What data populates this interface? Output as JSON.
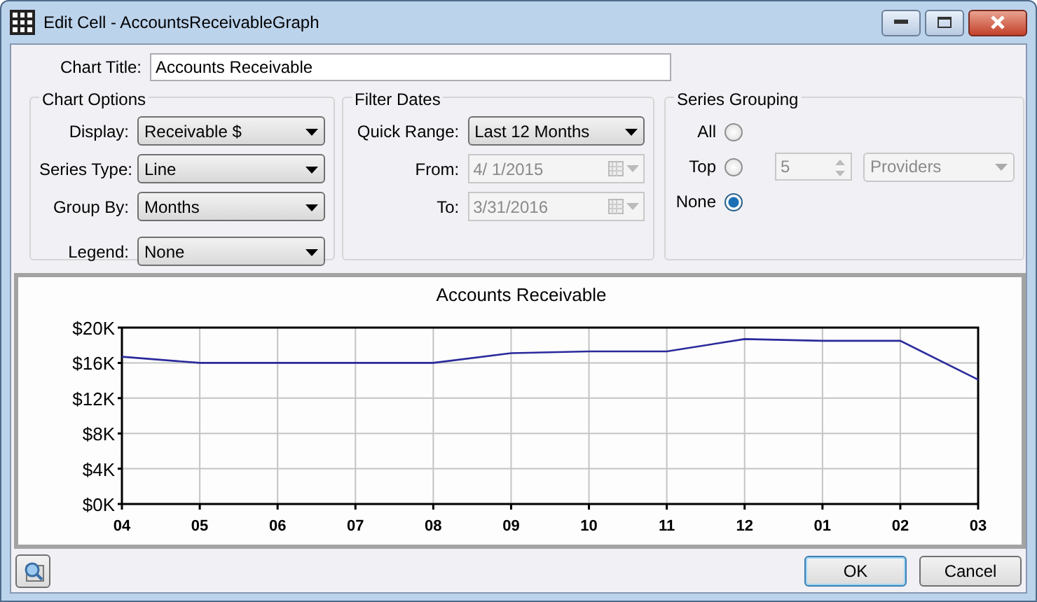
{
  "window": {
    "title": "Edit Cell - AccountsReceivableGraph"
  },
  "chart_title": {
    "label": "Chart Title:",
    "value": "Accounts Receivable"
  },
  "chart_options": {
    "title": "Chart Options",
    "fields": [
      {
        "label": "Display:",
        "value": "Receivable $"
      },
      {
        "label": "Series Type:",
        "value": "Line"
      },
      {
        "label": "Group By:",
        "value": "Months"
      },
      {
        "label": "Legend:",
        "value": "None"
      }
    ]
  },
  "filter_dates": {
    "title": "Filter Dates",
    "fields": [
      {
        "label": "Quick Range:",
        "value": "Last 12 Months",
        "kind": "dropdown",
        "disabled": false
      },
      {
        "label": "From:",
        "value": "4/ 1/2015",
        "kind": "date",
        "disabled": true
      },
      {
        "label": "To:",
        "value": "3/31/2016",
        "kind": "date",
        "disabled": true
      }
    ]
  },
  "series_grouping": {
    "title": "Series Grouping",
    "options": [
      {
        "label": "All",
        "selected": false
      },
      {
        "label": "Top",
        "selected": false
      },
      {
        "label": "None",
        "selected": true
      }
    ],
    "top_count": {
      "value": "5",
      "disabled": true
    },
    "group_field": {
      "value": "Providers",
      "disabled": true
    }
  },
  "chart": {
    "chart_data": {
      "type": "line",
      "title": "Accounts Receivable",
      "categories": [
        "04",
        "05",
        "06",
        "07",
        "08",
        "09",
        "10",
        "11",
        "12",
        "01",
        "02",
        "03"
      ],
      "grid": true,
      "series": [
        {
          "color": "#2a2a9c",
          "values": [
            16700,
            16000,
            16000,
            16000,
            16000,
            17100,
            17300,
            17300,
            18700,
            18500,
            18500,
            14100
          ]
        }
      ],
      "ylim": [
        0,
        20000
      ],
      "yticks": [
        {
          "value": 0,
          "label": "$0K"
        },
        {
          "value": 4000,
          "label": "$4K"
        },
        {
          "value": 8000,
          "label": "$8K"
        },
        {
          "value": 12000,
          "label": "$12K"
        },
        {
          "value": 16000,
          "label": "$16K"
        },
        {
          "value": 20000,
          "label": "$20K"
        }
      ]
    }
  },
  "buttons": [
    {
      "label": "OK",
      "default": true
    },
    {
      "label": "Cancel",
      "default": false
    }
  ]
}
